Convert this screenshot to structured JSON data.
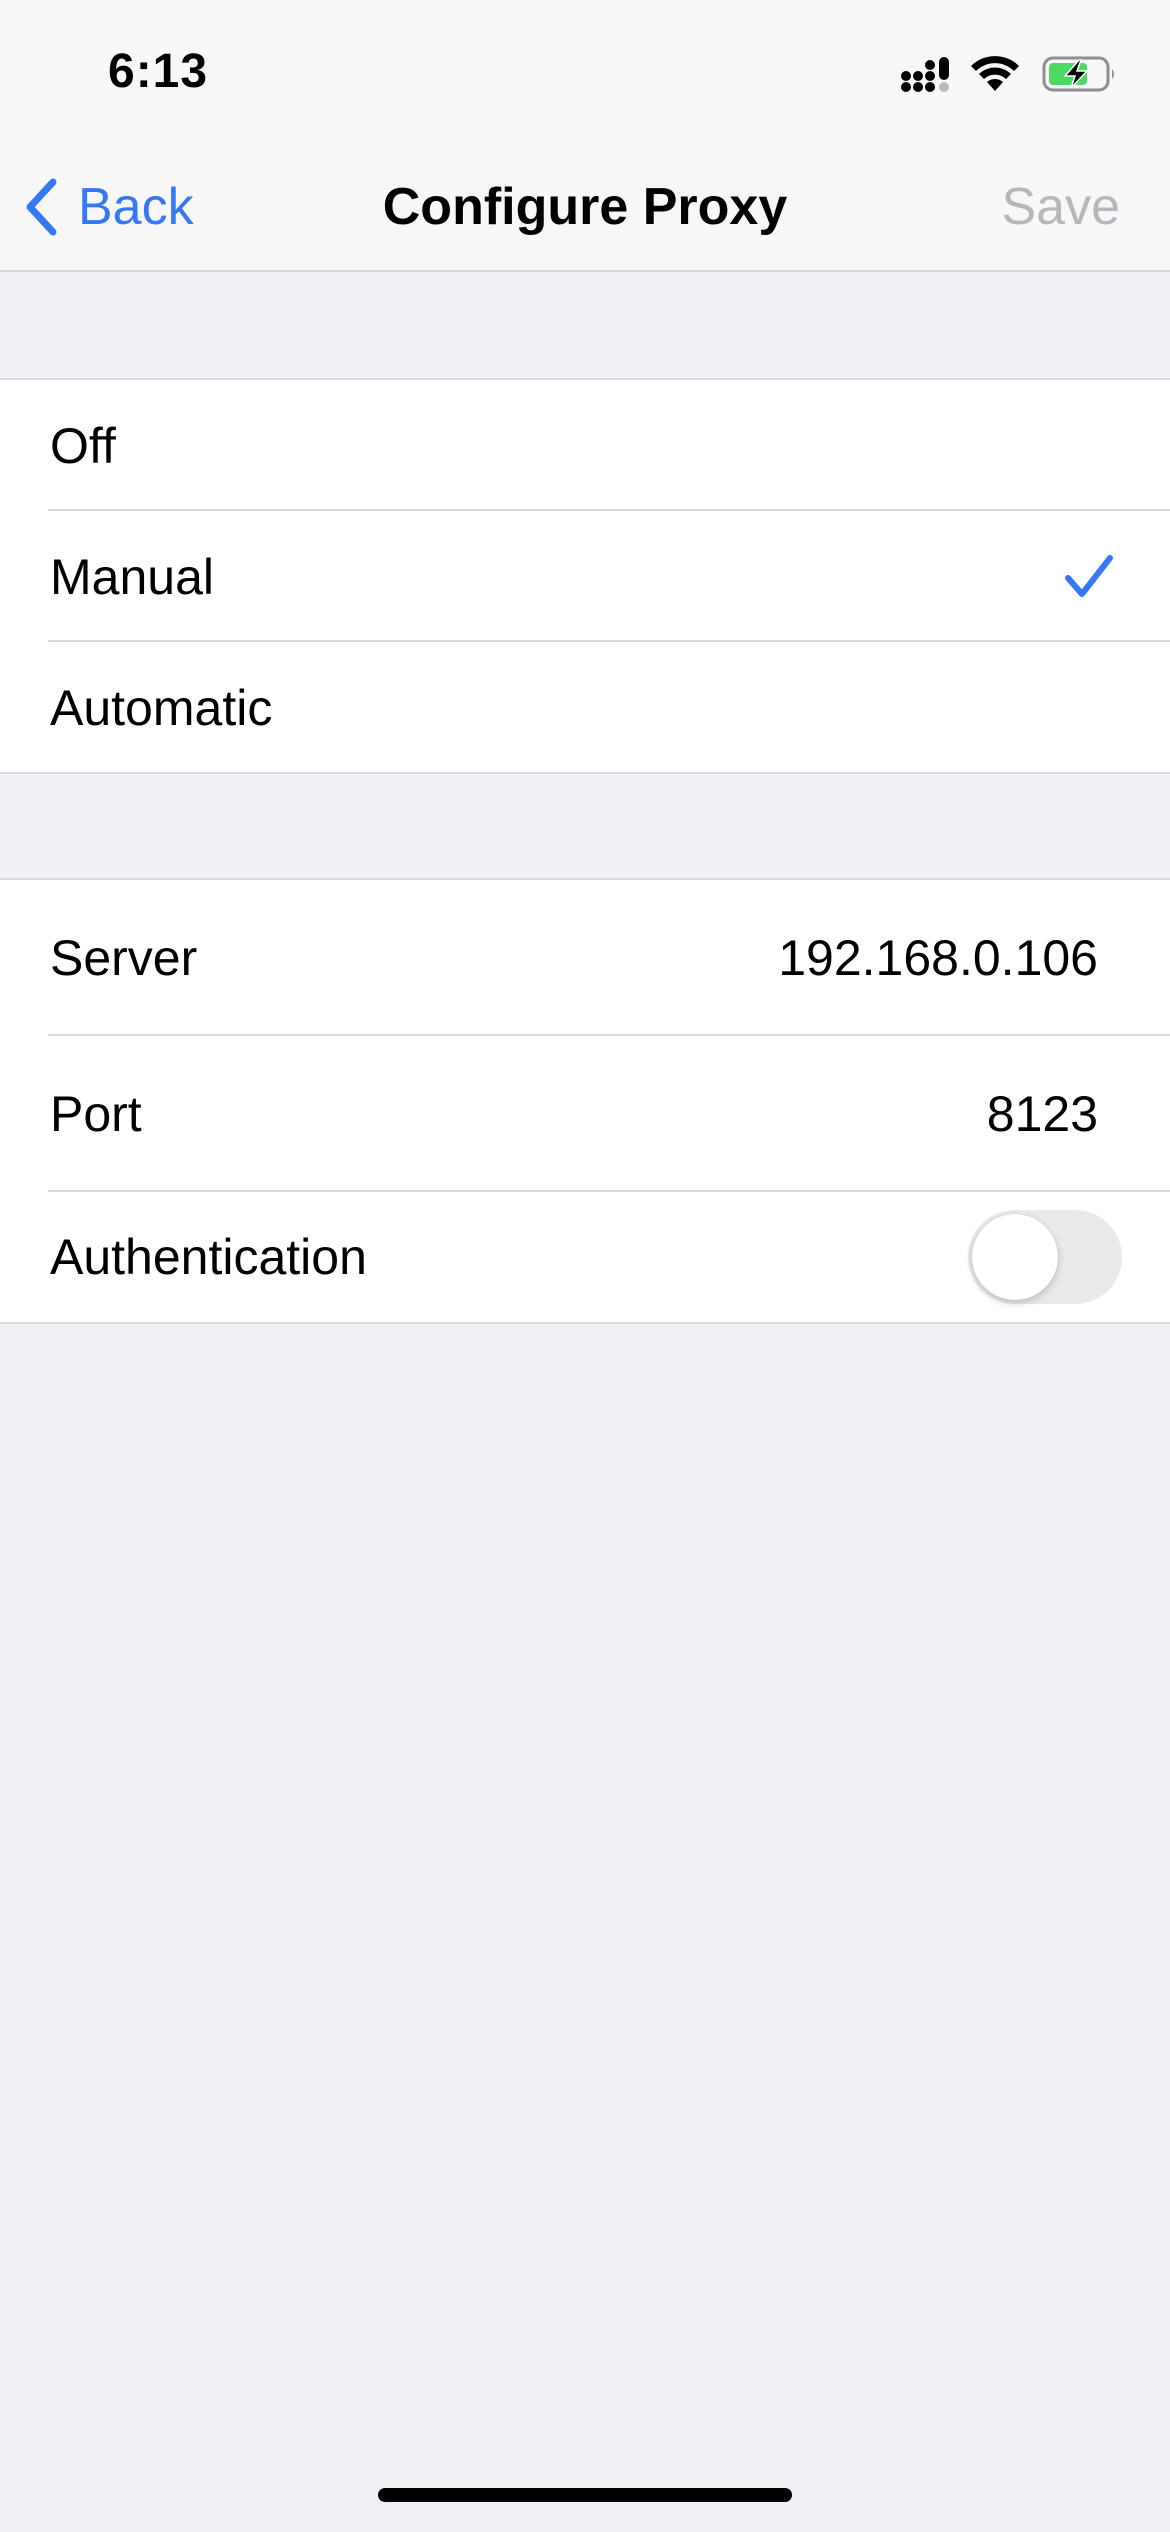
{
  "status_bar": {
    "time": "6:13"
  },
  "nav": {
    "back_label": "Back",
    "title": "Configure Proxy",
    "save_label": "Save"
  },
  "modes": {
    "items": [
      {
        "label": "Off"
      },
      {
        "label": "Manual"
      },
      {
        "label": "Automatic"
      }
    ],
    "selected": "Manual"
  },
  "proxy": {
    "server_label": "Server",
    "server_value": "192.168.0.106",
    "port_label": "Port",
    "port_value": "8123",
    "auth_label": "Authentication",
    "auth_enabled": false
  },
  "colors": {
    "accent": "#3478f6",
    "disabled_text": "#b7b7bb",
    "background": "#f0f0f5",
    "battery_fill": "#4cd964"
  },
  "icons": {
    "back": "chevron-left-icon",
    "selected": "checkmark-icon",
    "signal": "cellular-signal-icon",
    "wifi": "wifi-icon",
    "battery": "battery-charging-icon"
  }
}
